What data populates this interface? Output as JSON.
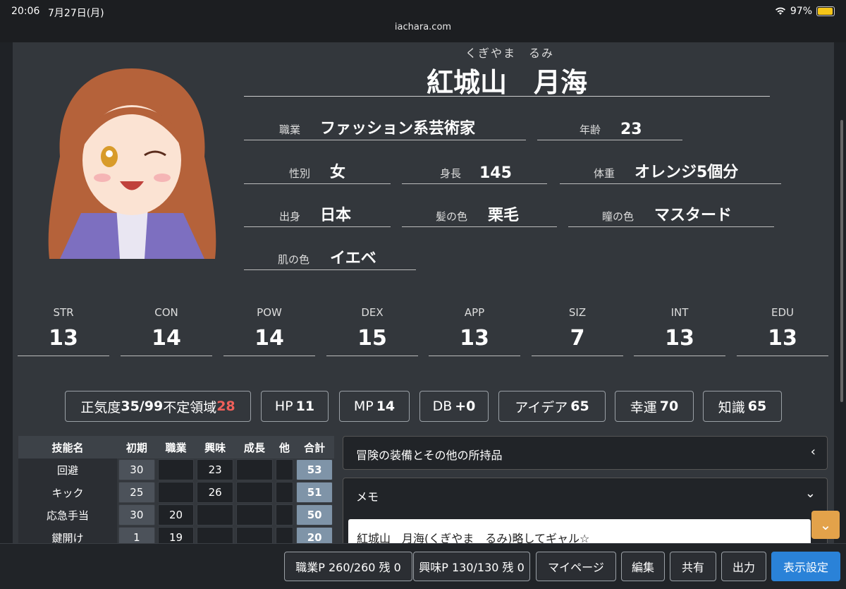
{
  "status": {
    "time": "20:06",
    "date": "7月27日(月)",
    "battery": "97%",
    "battery_level": 0.97
  },
  "browser": {
    "url": "iachara.com"
  },
  "character": {
    "ruby": "くぎやま　るみ",
    "name": "紅城山　月海",
    "fields": {
      "occupation": {
        "label": "職業",
        "value": "ファッション系芸術家"
      },
      "age": {
        "label": "年齢",
        "value": "23"
      },
      "sex": {
        "label": "性別",
        "value": "女"
      },
      "height": {
        "label": "身長",
        "value": "145"
      },
      "weight": {
        "label": "体重",
        "value": "オレンジ5個分"
      },
      "birthplace": {
        "label": "出身",
        "value": "日本"
      },
      "hair": {
        "label": "髪の色",
        "value": "栗毛"
      },
      "eyes": {
        "label": "瞳の色",
        "value": "マスタード"
      },
      "skin": {
        "label": "肌の色",
        "value": "イエベ"
      }
    }
  },
  "stats": [
    {
      "name": "STR",
      "value": "13"
    },
    {
      "name": "CON",
      "value": "14"
    },
    {
      "name": "POW",
      "value": "14"
    },
    {
      "name": "DEX",
      "value": "15"
    },
    {
      "name": "APP",
      "value": "13"
    },
    {
      "name": "SIZ",
      "value": "7"
    },
    {
      "name": "INT",
      "value": "13"
    },
    {
      "name": "EDU",
      "value": "13"
    }
  ],
  "derived": {
    "sanity": {
      "label": "正気度",
      "value": "35/99",
      "extra_label": "不定領域",
      "extra_value": "28"
    },
    "hp": {
      "label": "HP",
      "value": "11"
    },
    "mp": {
      "label": "MP",
      "value": "14"
    },
    "db": {
      "label": "DB",
      "value": "+0"
    },
    "idea": {
      "label": "アイデア",
      "value": "65"
    },
    "luck": {
      "label": "幸運",
      "value": "70"
    },
    "know": {
      "label": "知識",
      "value": "65"
    }
  },
  "skills": {
    "headers": [
      "技能名",
      "初期",
      "職業",
      "興味",
      "成長",
      "他",
      "合計"
    ],
    "rows": [
      {
        "name": "回避",
        "init": "30",
        "job": "",
        "interest": "23",
        "growth": "",
        "other": "",
        "total": "53"
      },
      {
        "name": "キック",
        "init": "25",
        "job": "",
        "interest": "26",
        "growth": "",
        "other": "",
        "total": "51"
      },
      {
        "name": "応急手当",
        "init": "30",
        "job": "20",
        "interest": "",
        "growth": "",
        "other": "",
        "total": "50"
      },
      {
        "name": "鍵開け",
        "init": "1",
        "job": "19",
        "interest": "",
        "growth": "",
        "other": "",
        "total": "20"
      }
    ]
  },
  "sections": {
    "equipment": {
      "title": "冒険の装備とその他の所持品",
      "chevron": "‹"
    },
    "memo": {
      "title": "メモ",
      "chevron": "⌄",
      "text": "紅城山　月海(くぎやま　るみ)略してギャル☆"
    }
  },
  "bottom": {
    "job_points": "職業P 260/260 残 0",
    "interest_points": "興味P 130/130 残 0",
    "mypage": "マイページ",
    "edit": "編集",
    "share": "共有",
    "output": "出力",
    "display": "表示設定"
  },
  "colors": {
    "accent": "#2a82d8",
    "danger": "#f0605a",
    "scroll_top": "#e3a24a"
  }
}
